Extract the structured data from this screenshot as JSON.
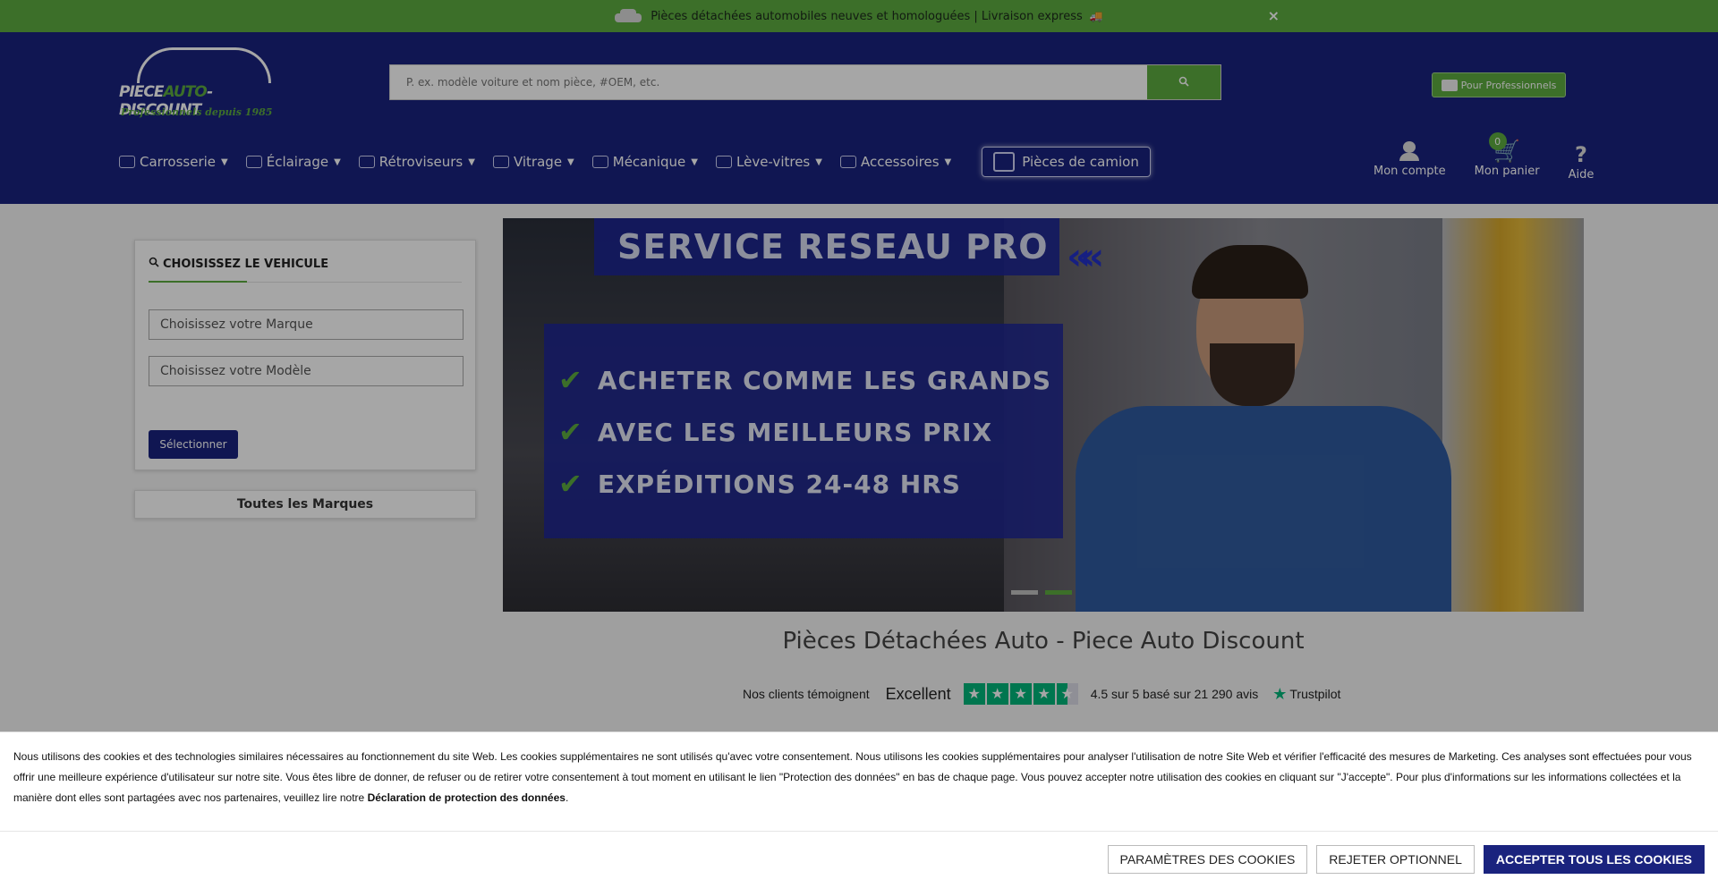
{
  "promo": {
    "text": "Pièces détachées automobiles neuves et homologuées | Livraison express",
    "close": "×"
  },
  "header": {
    "logo_part1": "PIECE",
    "logo_part2": "AUTO",
    "logo_part3": "-DISCOUNT",
    "logo_tagline": "Professionnels depuis 1985",
    "search_placeholder": "P. ex. modèle voiture et nom pièce, #OEM, etc.",
    "pro_button": "Pour Professionnels",
    "nav": [
      {
        "label": "Carrosserie"
      },
      {
        "label": "Éclairage"
      },
      {
        "label": "Rétroviseurs"
      },
      {
        "label": "Vitrage"
      },
      {
        "label": "Mécanique"
      },
      {
        "label": "Lève-vitres"
      },
      {
        "label": "Accessoires"
      }
    ],
    "truck_button": "Pièces de camion",
    "account_label": "Mon compte",
    "cart_label": "Mon panier",
    "cart_count": "0",
    "help_label": "Aide"
  },
  "vehicle": {
    "title": "CHOISISSEZ LE VEHICULE",
    "brand_placeholder": "Choisissez votre Marque",
    "model_placeholder": "Choisissez votre Modèle",
    "select_button": "Sélectionner",
    "all_brands": "Toutes les Marques"
  },
  "banner": {
    "heading": "SERVICE RESEAU PRO",
    "arrows": "«",
    "lines": [
      "ACHETER COMME LES GRANDS",
      "AVEC LES MEILLEURS PRIX",
      "EXPÉDITIONS 24-48 HRS"
    ],
    "active_slide": 2,
    "slide_count": 2
  },
  "page_title": "Pièces Détachées Auto - Piece Auto Discount",
  "trustpilot": {
    "label": "Nos clients témoignent",
    "rating_word": "Excellent",
    "stars": 4.5,
    "summary": "4.5 sur 5 basé sur 21 290 avis",
    "brand": "Trustpilot"
  },
  "cookie": {
    "text": "Nous utilisons des cookies et des technologies similaires nécessaires au fonctionnement du site Web. Les cookies supplémentaires ne sont utilisés qu'avec votre consentement. Nous utilisons les cookies supplémentaires pour analyser l'utilisation de notre Site Web et vérifier l'efficacité des mesures de Marketing. Ces analyses sont effectuées pour vous offrir une meilleure expérience d'utilisateur sur notre site. Vous êtes libre de donner, de refuser ou de retirer votre consentement à tout moment en utilisant le lien \"Protection des données\" en bas de chaque page. Vous pouvez accepter notre utilisation des cookies en cliquant sur \"J'accepte\". Pour plus d'informations sur les informations collectées et la manière dont elles sont partagées avec nos partenaires, veuillez lire notre ",
    "link": "Déclaration de protection des données",
    "text_end": ".",
    "settings_button": "PARAMÈTRES DES COOKIES",
    "reject_button": "REJETER OPTIONNEL",
    "accept_button": "ACCEPTER TOUS LES COOKIES"
  },
  "colors": {
    "brand_blue": "#1a237e",
    "brand_green": "#5cab3f",
    "trustpilot_green": "#00b67a"
  }
}
